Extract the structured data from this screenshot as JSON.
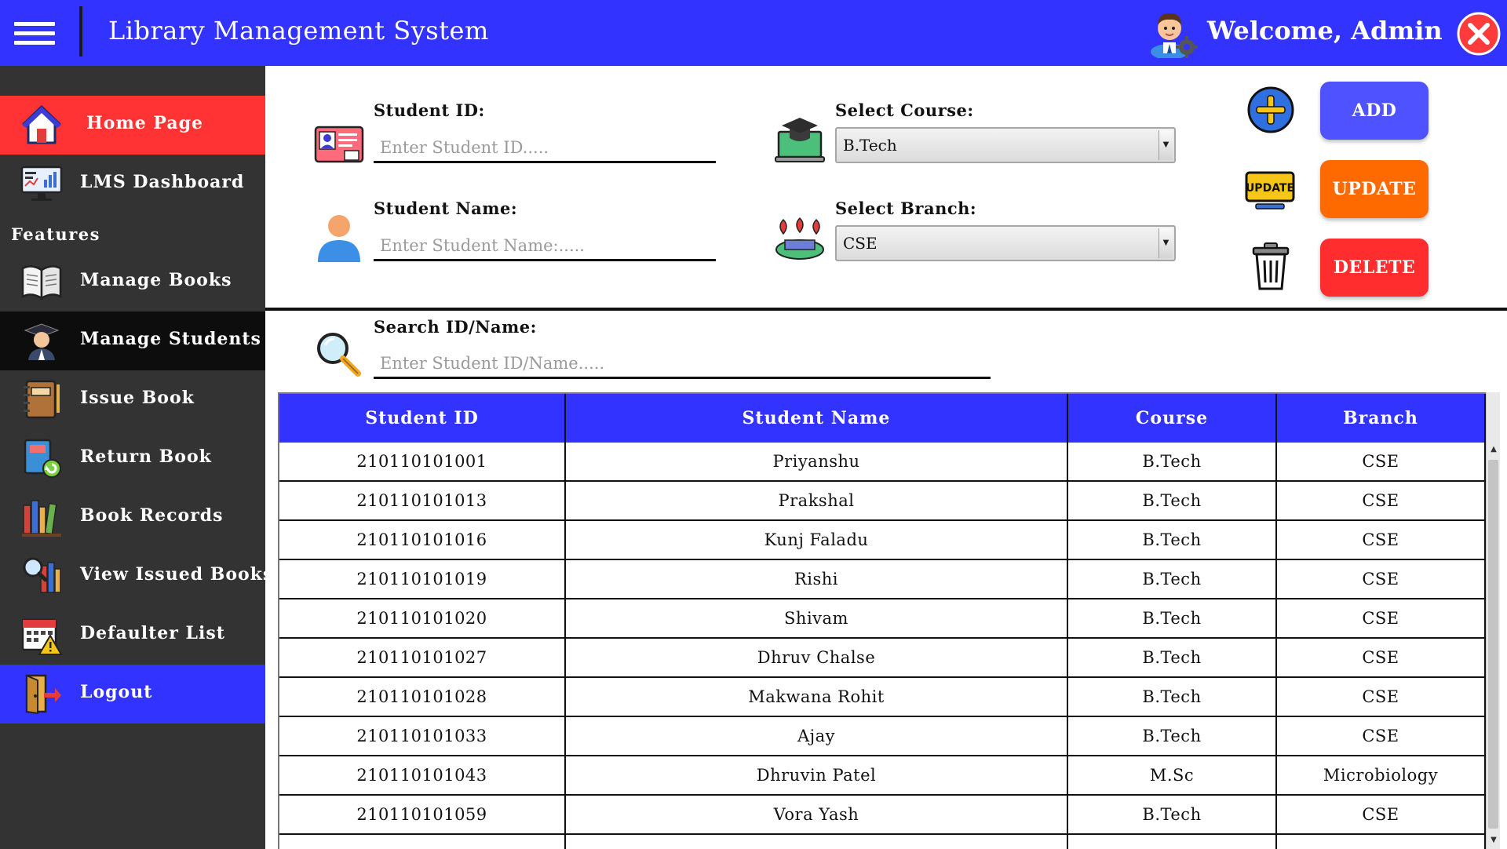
{
  "header": {
    "title": "Library Management System",
    "welcome": "Welcome, Admin",
    "accent_color": "#3333ff"
  },
  "sidebar": {
    "features_heading": "Features",
    "items": [
      {
        "label": "Home Page",
        "icon": "home-icon"
      },
      {
        "label": "LMS Dashboard",
        "icon": "dashboard-icon"
      },
      {
        "label": "Manage Books",
        "icon": "open-book-icon"
      },
      {
        "label": "Manage Students",
        "icon": "student-icon"
      },
      {
        "label": "Issue Book",
        "icon": "notebook-icon"
      },
      {
        "label": "Return Book",
        "icon": "return-book-icon"
      },
      {
        "label": "Book Records",
        "icon": "bookshelf-icon"
      },
      {
        "label": "View Issued Books",
        "icon": "search-books-icon"
      },
      {
        "label": "Defaulter List",
        "icon": "calendar-warning-icon"
      },
      {
        "label": "Logout",
        "icon": "logout-door-icon"
      }
    ],
    "active_item": "Manage Students"
  },
  "form": {
    "student_id_label": "Student ID:",
    "student_id_placeholder": "Enter Student ID.....",
    "student_name_label": "Student Name:",
    "student_name_placeholder": "Enter Student Name:.....",
    "course_label": "Select Course:",
    "course_value": "B.Tech",
    "branch_label": "Select Branch:",
    "branch_value": "CSE",
    "search_label": "Search ID/Name:",
    "search_placeholder": "Enter Student ID/Name....."
  },
  "actions": {
    "add_label": "ADD",
    "update_label": "UPDATE",
    "delete_label": "DELETE",
    "update_icon_text": "UPDATE"
  },
  "table": {
    "columns": [
      "Student ID",
      "Student Name",
      "Course",
      "Branch"
    ],
    "rows": [
      [
        "210110101001",
        "Priyanshu",
        "B.Tech",
        "CSE"
      ],
      [
        "210110101013",
        "Prakshal",
        "B.Tech",
        "CSE"
      ],
      [
        "210110101016",
        "Kunj Faladu",
        "B.Tech",
        "CSE"
      ],
      [
        "210110101019",
        "Rishi",
        "B.Tech",
        "CSE"
      ],
      [
        "210110101020",
        "Shivam",
        "B.Tech",
        "CSE"
      ],
      [
        "210110101027",
        "Dhruv Chalse",
        "B.Tech",
        "CSE"
      ],
      [
        "210110101028",
        "Makwana Rohit",
        "B.Tech",
        "CSE"
      ],
      [
        "210110101033",
        "Ajay",
        "B.Tech",
        "CSE"
      ],
      [
        "210110101043",
        "Dhruvin Patel",
        "M.Sc",
        "Microbiology"
      ],
      [
        "210110101059",
        "Vora Yash",
        "B.Tech",
        "CSE"
      ],
      [
        "",
        "",
        "",
        ""
      ]
    ]
  }
}
